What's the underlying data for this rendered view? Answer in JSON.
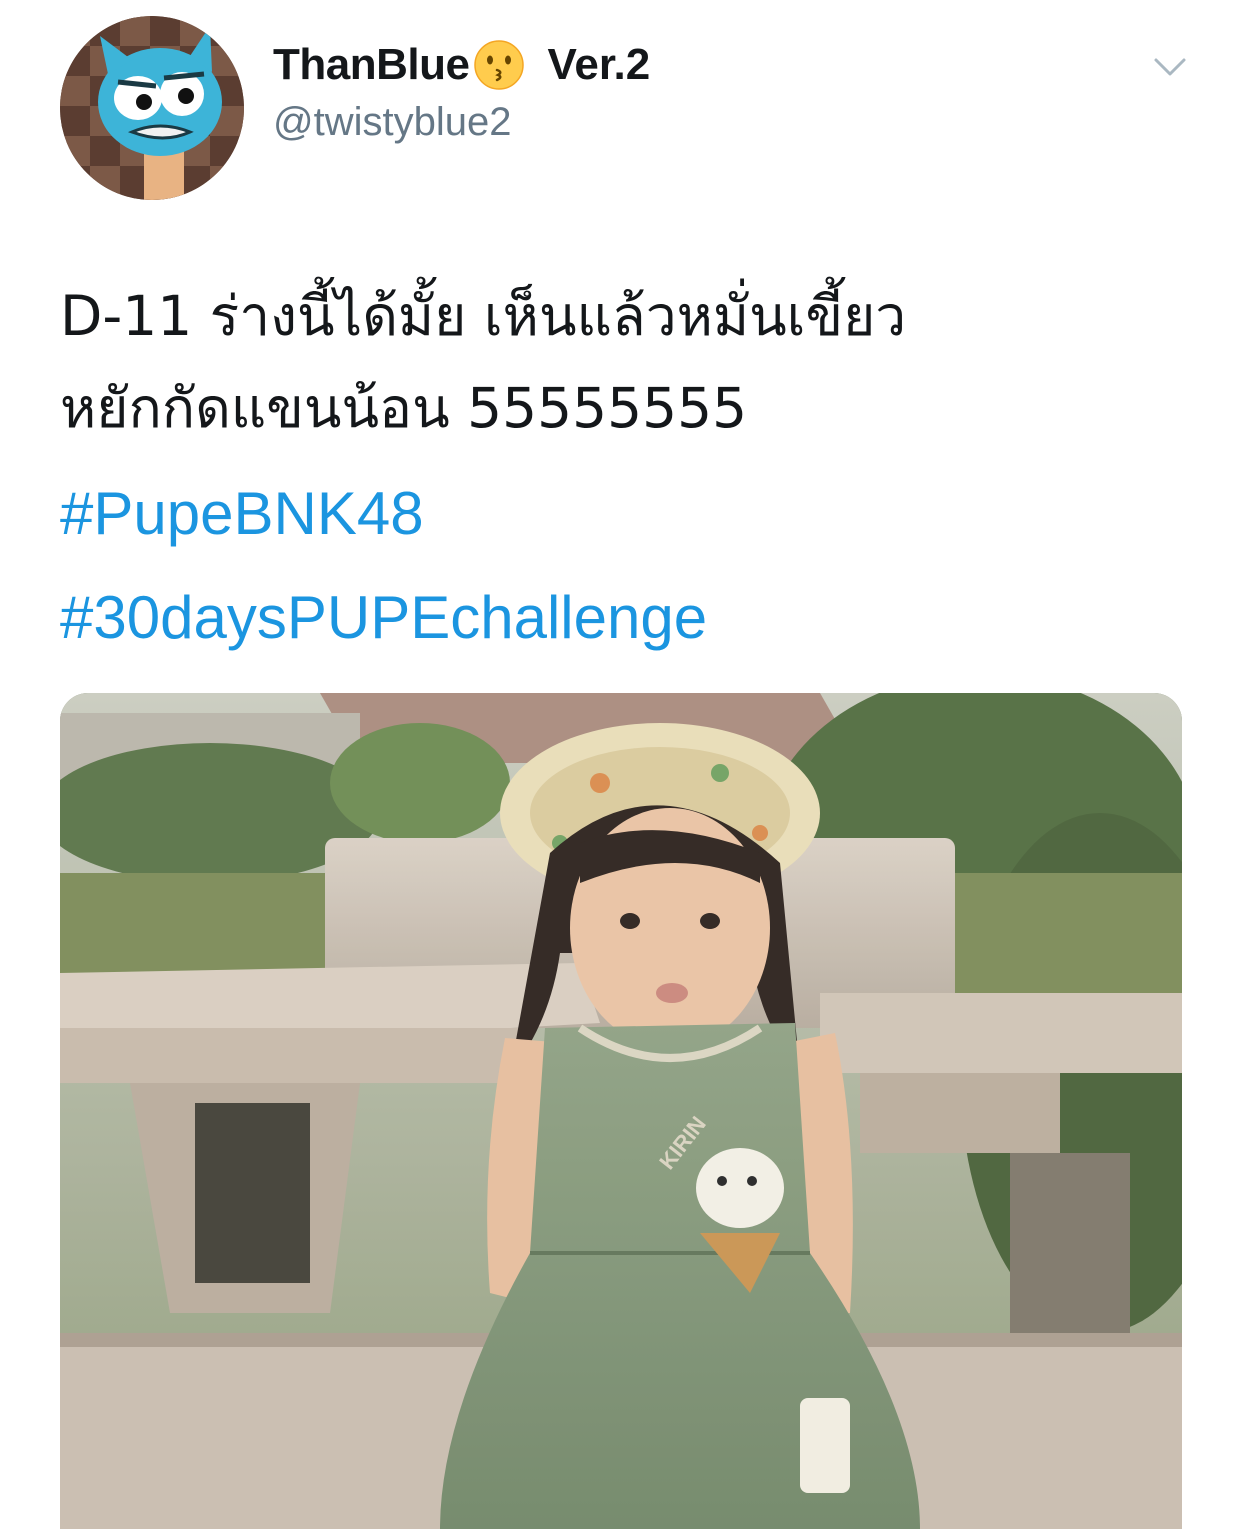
{
  "tweet": {
    "display_name": "ThanBlue",
    "name_emoji": "kissing-face-emoji",
    "name_suffix": "Ver.2",
    "handle": "@twistyblue2",
    "text_line1": "D-11 ร่างนี้ได้มั้ย เห็นแล้วหมั่นเขี้ยว",
    "text_line2": "หยักกัดแขนน้อน 55555555",
    "hashtags": [
      "#PupeBNK48",
      "#30daysPUPEchallenge"
    ],
    "photo_label": "KIRIN"
  },
  "colors": {
    "hashtag": "#1b95e0",
    "handle": "#657786",
    "text": "#14171a"
  }
}
